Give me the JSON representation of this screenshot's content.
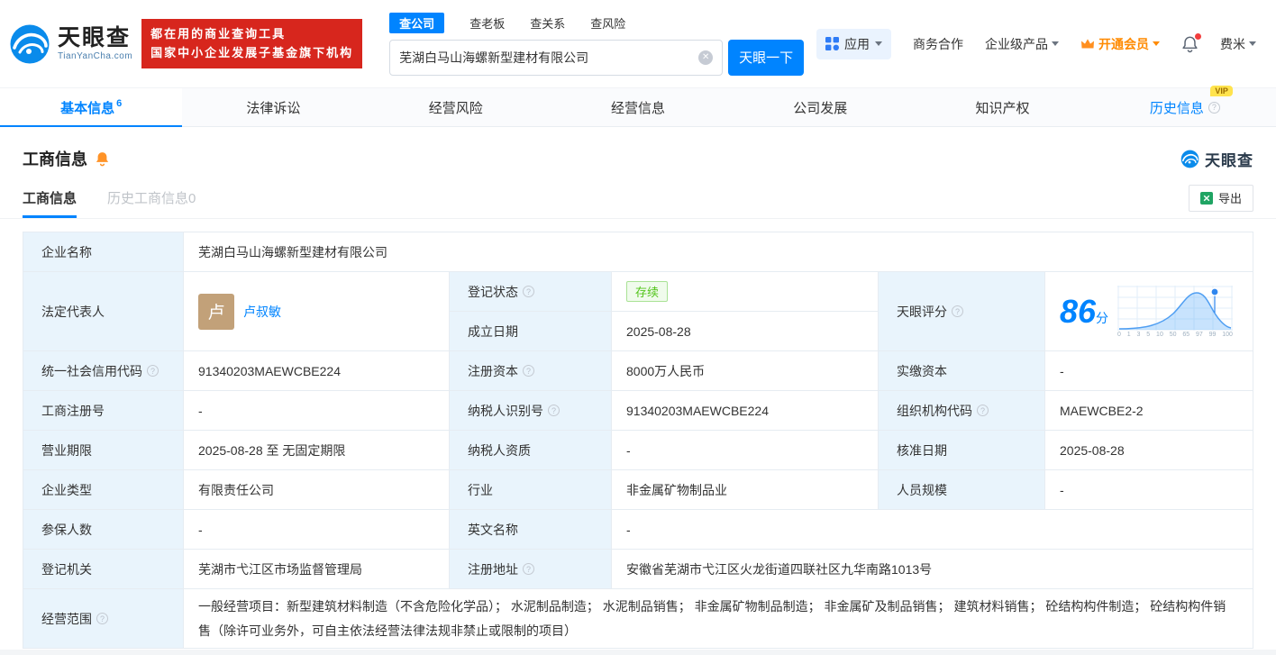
{
  "colors": {
    "accent": "#0084ff",
    "banner_bg": "#d7261d",
    "vip_badge_bg": "#ffe34d",
    "status_green": "#52c41a",
    "member_orange": "#ff8a00"
  },
  "header": {
    "logo_title": "天眼查",
    "logo_domain": "TianYanCha.com",
    "banner_line1": "都在用的商业查询工具",
    "banner_line2": "国家中小企业发展子基金旗下机构",
    "search_tabs": [
      {
        "label": "查公司"
      },
      {
        "label": "查老板"
      },
      {
        "label": "查关系"
      },
      {
        "label": "查风险"
      }
    ],
    "search_value": "芜湖白马山海螺新型建材有限公司",
    "search_button": "天眼一下",
    "nav_apps": "应用",
    "nav_cooperation": "商务合作",
    "nav_enterprise": "企业级产品",
    "nav_vip": "开通会员",
    "nav_user": "费米"
  },
  "tabs": {
    "basic": "基本信息",
    "basic_count": "6",
    "legal": "法律诉讼",
    "risk": "经营风险",
    "business": "经营信息",
    "development": "公司发展",
    "ip": "知识产权",
    "history": "历史信息",
    "history_vip": "VIP"
  },
  "section": {
    "title": "工商信息",
    "brand": "天眼查"
  },
  "subtabs": {
    "current": "工商信息",
    "history": "历史工商信息0",
    "export": "导出"
  },
  "info": {
    "company_name_label": "企业名称",
    "company_name": "芜湖白马山海螺新型建材有限公司",
    "legal_rep_label": "法定代表人",
    "legal_rep_avatar": "卢",
    "legal_rep_name": "卢叔敏",
    "reg_status_label": "登记状态",
    "reg_status": "存续",
    "establish_date_label": "成立日期",
    "establish_date": "2025-08-28",
    "score_label": "天眼评分",
    "score_value": "86",
    "score_unit": "分",
    "score_axis": [
      "0",
      "1",
      "3",
      "5",
      "10",
      "50",
      "65",
      "97",
      "99",
      "100"
    ],
    "credit_code_label": "统一社会信用代码",
    "credit_code": "91340203MAEWCBE224",
    "reg_capital_label": "注册资本",
    "reg_capital": "8000万人民币",
    "paid_capital_label": "实缴资本",
    "paid_capital": "-",
    "reg_number_label": "工商注册号",
    "reg_number": "-",
    "taxpayer_id_label": "纳税人识别号",
    "taxpayer_id": "91340203MAEWCBE224",
    "org_code_label": "组织机构代码",
    "org_code": "MAEWCBE2-2",
    "business_term_label": "营业期限",
    "business_term": "2025-08-28 至 无固定期限",
    "taxpayer_quality_label": "纳税人资质",
    "taxpayer_quality": "-",
    "approval_date_label": "核准日期",
    "approval_date": "2025-08-28",
    "company_type_label": "企业类型",
    "company_type": "有限责任公司",
    "industry_label": "行业",
    "industry": "非金属矿物制品业",
    "staff_size_label": "人员规模",
    "staff_size": "-",
    "insured_label": "参保人数",
    "insured": "-",
    "english_name_label": "英文名称",
    "english_name": "-",
    "reg_authority_label": "登记机关",
    "reg_authority": "芜湖市弋江区市场监督管理局",
    "reg_address_label": "注册地址",
    "reg_address": "安徽省芜湖市弋江区火龙街道四联社区九华南路1013号",
    "business_scope_label": "经营范围",
    "business_scope": "一般经营项目：新型建筑材料制造（不含危险化学品）； 水泥制品制造； 水泥制品销售； 非金属矿物制品制造； 非金属矿及制品销售； 建筑材料销售； 砼结构构件制造； 砼结构构件销售（除许可业务外，可自主依法经营法律法规非禁止或限制的项目）"
  },
  "icons": {
    "help": "?",
    "clear": "✕"
  }
}
